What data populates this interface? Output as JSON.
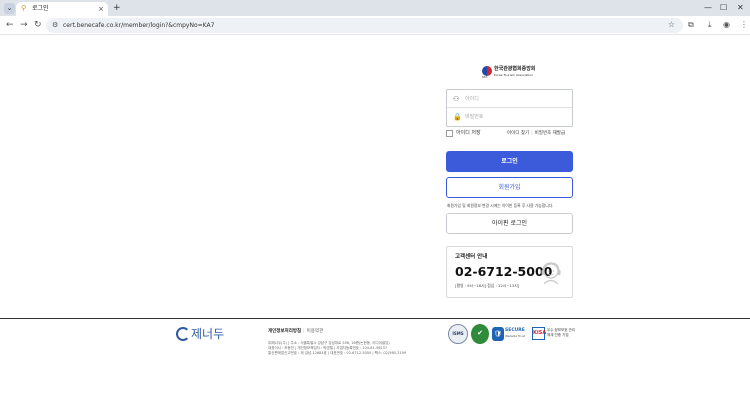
{
  "browser": {
    "tab_title": "로그인",
    "new_tab": "+",
    "url": "cert.benecafe.co.kr/member/login?&cmpyNo=KA7",
    "tab_close": "×",
    "minimize": "—",
    "maximize": "☐",
    "close": "✕"
  },
  "logo": {
    "org_ko": "한국관광협회중앙회",
    "org_en": "Korea Tourism Association",
    "sub": "KTA"
  },
  "login": {
    "id_placeholder": "아이디",
    "pw_placeholder": "비밀번호",
    "save_id": "아이디 저장",
    "find_id": "아이디 찾기",
    "reset_pw": "비밀번호 재발급",
    "login_button": "로그인",
    "join_button": "회원가입",
    "notice": "회원가입 및 회원정보 변경 시에는 아이핀 등록 후 사용 가능합니다.",
    "ipin_button": "아이핀 로그인"
  },
  "support": {
    "title": "고객센터 안내",
    "phone": "02-6712-5000",
    "hours": "[평일 : 9시~18시] 점심 : 12시~13시]"
  },
  "footer": {
    "logo_text": "제너두",
    "privacy": "개인정보처리방침",
    "terms": "이용약관",
    "info_lines": [
      "㈜제너두(주) | 주소 : 서울특별시 강남구 강남대로 556, 16층(논현동, 이디야빌딩)",
      "대표이사 : 조동찬 | 개인정보책임자 : 박영철 | 사업자등록번호 : 104-81-56237",
      "통신판매업신고번호 : 제 강남-12684호 | 대표번호 : 02-6712-5000 | 팩스: 02)560-2199"
    ],
    "certs": {
      "isms": "ISMS",
      "secure": "SECURE",
      "secure_sub": "Website Trust",
      "kisa_mark": "KISA",
      "kisa": "우수 정보보호 관리체계 인증 기업"
    }
  },
  "icons": {
    "tab_menu": "⌄",
    "favicon": "⚲",
    "back": "←",
    "forward": "→",
    "reload": "↻",
    "site_info": "⚙",
    "bookmark": "☆",
    "extensions": "⧉",
    "download": "⤓",
    "profile": "◉",
    "menu": "⋮",
    "user": "⚇",
    "lock": "🔒",
    "green_cert": "✔",
    "secure_mark": "🛡"
  }
}
